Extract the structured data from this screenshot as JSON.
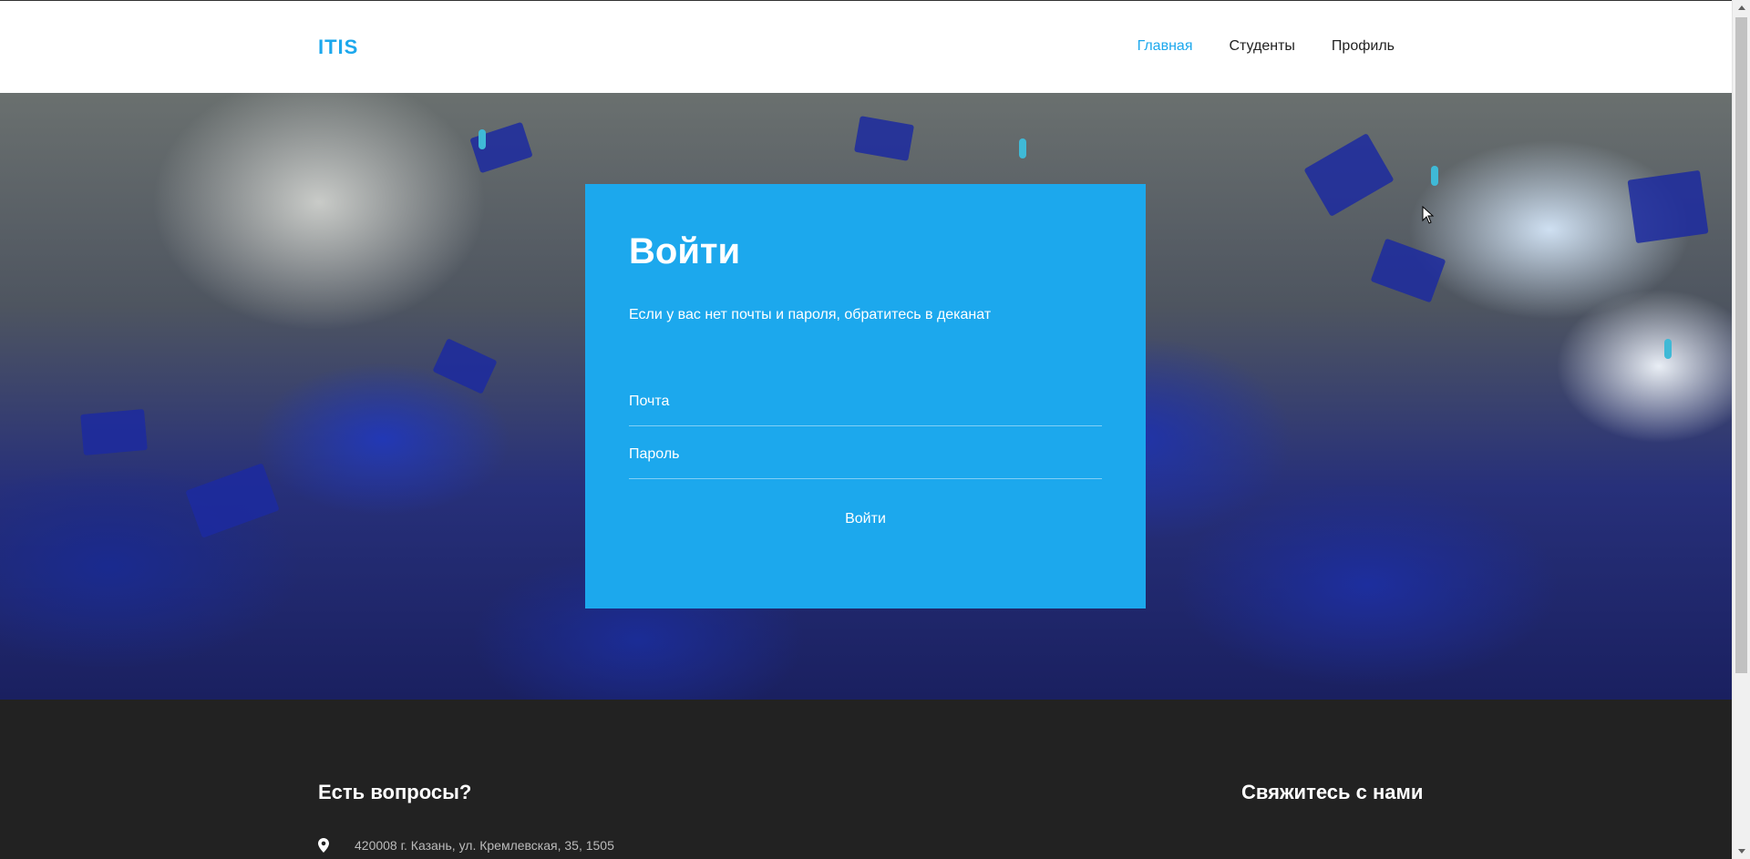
{
  "brand": {
    "logo": "ITIS",
    "accent": "#1ca8ed"
  },
  "nav": {
    "items": [
      {
        "label": "Главная",
        "active": true
      },
      {
        "label": "Студенты",
        "active": false
      },
      {
        "label": "Профиль",
        "active": false
      }
    ]
  },
  "login": {
    "title": "Войти",
    "subtitle": "Если у вас нет почты и пароля, обратитесь в деканат",
    "email_placeholder": "Почта",
    "password_placeholder": "Пароль",
    "submit_label": "Войти"
  },
  "footer": {
    "questions_heading": "Есть вопросы?",
    "contact_heading": "Свяжитесь с нами",
    "address": "420008 г. Казань, ул. Кремлевская, 35, 1505",
    "address_icon": "map-pin-icon"
  }
}
